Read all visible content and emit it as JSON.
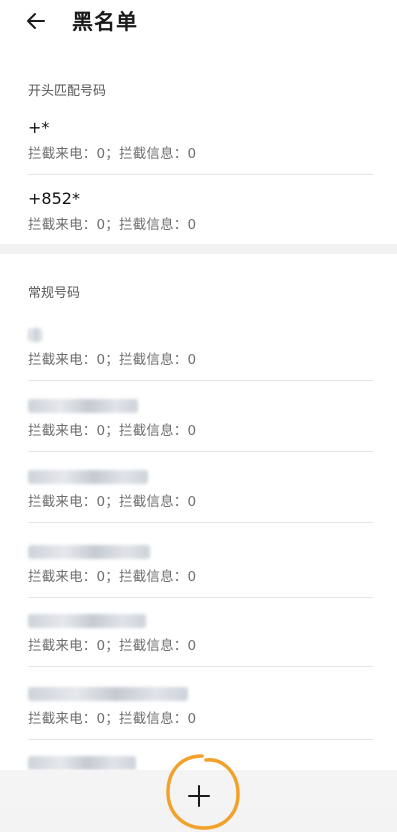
{
  "header": {
    "title": "黑名单"
  },
  "sections": {
    "prefix_label": "开头匹配号码",
    "regular_label": "常规号码"
  },
  "prefix_items": [
    {
      "number": "+*",
      "stats": "拦截来电：0；拦截信息：0"
    },
    {
      "number": "+852*",
      "stats": "拦截来电：0；拦截信息：0"
    }
  ],
  "regular_items": [
    {
      "stats": "拦截来电：0；拦截信息：0"
    },
    {
      "stats": "拦截来电：0；拦截信息：0"
    },
    {
      "stats": "拦截来电：0；拦截信息：0"
    },
    {
      "stats": "拦截来电：0；拦截信息：0"
    },
    {
      "stats": "拦截来电：0；拦截信息：0"
    },
    {
      "stats": "拦截来电：0；拦截信息：0"
    }
  ],
  "colors": {
    "accent_annotation": "#f2a12b"
  },
  "icons": {
    "back": "arrow-left-icon",
    "add": "plus-icon"
  }
}
